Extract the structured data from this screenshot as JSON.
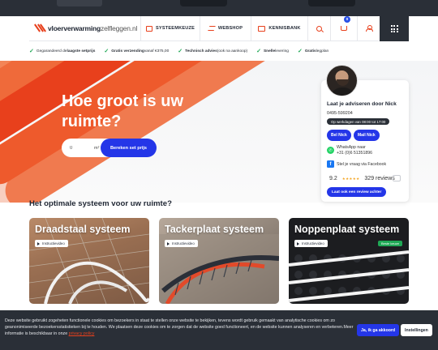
{
  "header": {
    "logo_main": "vloerverwarming",
    "logo_tail": "zelfleggen.nl",
    "nav": [
      {
        "label": "SYSTEEMKEUZE",
        "icon": "calculator-icon"
      },
      {
        "label": "WEBSHOP",
        "icon": "heating-wave-icon"
      },
      {
        "label": "KENNISBANK",
        "icon": "book-icon"
      }
    ],
    "cart_count": "0"
  },
  "usps": [
    {
      "pre": "Gegarandeerd de ",
      "bold": "laagste setprijs",
      "post": ""
    },
    {
      "pre": "",
      "bold": "Gratis verzending",
      "post": " vanaf €375,00"
    },
    {
      "pre": "",
      "bold": "Technisch advies",
      "post": " (ook na aankoop)"
    },
    {
      "pre": "",
      "bold": "Snelle",
      "post": " levering"
    },
    {
      "pre": "",
      "bold": "Gratis",
      "post": " legplan"
    }
  ],
  "hero": {
    "title": "Hoe groot is uw ruimte?",
    "input_value": "0",
    "unit": "m²",
    "button": "Bereken set prijs"
  },
  "advisor": {
    "title": "Laat je adviseren door Nick",
    "phone": "0495-599204",
    "hours": "Op werkdagen van 08:00 tot 17:00",
    "call_button": "Bel Nick",
    "mail_button": "Mail Nick",
    "whatsapp_label": "WhatsApp naar",
    "whatsapp_number": "+31 (0)6 51351896",
    "facebook": "Stel je vraag via Facebook",
    "rating": "9.2",
    "stars": "★★★★★",
    "reviews": "329 reviews",
    "review_button": "Laat ook een review achter"
  },
  "section": {
    "title": "Het optimale systeem voor uw ruimte?",
    "cards": [
      {
        "title": "Draadstaal systeem",
        "video": "Instructievideo",
        "badge": ""
      },
      {
        "title": "Tackerplaat systeem",
        "video": "Instructievideo",
        "badge": ""
      },
      {
        "title": "Noppenplaat systeem",
        "video": "Instructievideo",
        "badge": "Beste keuze"
      }
    ]
  },
  "cookie": {
    "text": "Deze website gebruikt zogeheten functionele cookies om bezoekers in staat te stellen onze website te bekijken, tevens wordt gebruik gemaakt van analytische cookies om zo geanonimiseerde bezoekersstatistieken bij te houden. We plaatsen deze cookies om te zorgen dat de website goed functioneert, en de website kunnen analyseren en verbeteren.Meer informatie is beschikbaar in onze ",
    "link": "privacy policy",
    "accept": "Ja, ik ga akkoord",
    "settings": "Instellingen"
  },
  "colors": {
    "accent": "#e8401c",
    "primary_button": "#2436e8",
    "dark": "#2a2f37",
    "success": "#1fa855"
  }
}
